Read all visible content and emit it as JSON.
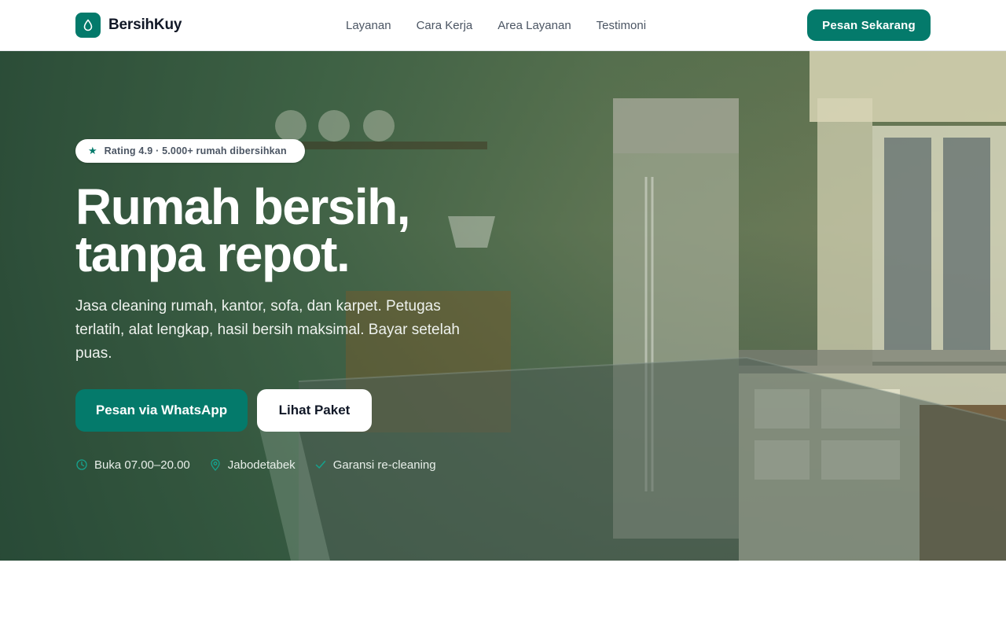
{
  "header": {
    "brand_name": "BersihKuy",
    "brand_icon": "droplet-icon",
    "nav": [
      {
        "label": "Layanan"
      },
      {
        "label": "Cara Kerja"
      },
      {
        "label": "Area Layanan"
      },
      {
        "label": "Testimoni"
      }
    ],
    "cta_label": "Pesan Sekarang"
  },
  "hero": {
    "badge_icon": "star-icon",
    "badge_text": "Rating 4.9 · 5.000+ rumah dibersihkan",
    "title_line1": "Rumah bersih,",
    "title_line2": "tanpa repot.",
    "description": "Jasa cleaning rumah, kantor, sofa, dan karpet. Petugas terlatih, alat lengkap, hasil bersih maksimal. Bayar setelah puas.",
    "primary_button": "Pesan via WhatsApp",
    "secondary_button": "Lihat Paket",
    "features": [
      {
        "icon": "clock-icon",
        "label": "Buka 07.00–20.00"
      },
      {
        "icon": "map-pin-icon",
        "label": "Jabodetabek"
      },
      {
        "icon": "check-icon",
        "label": "Garansi re-cleaning"
      }
    ]
  },
  "colors": {
    "brand": "#047a6b",
    "hero_overlay": "#0b3a2a",
    "text_dark": "#111827"
  }
}
